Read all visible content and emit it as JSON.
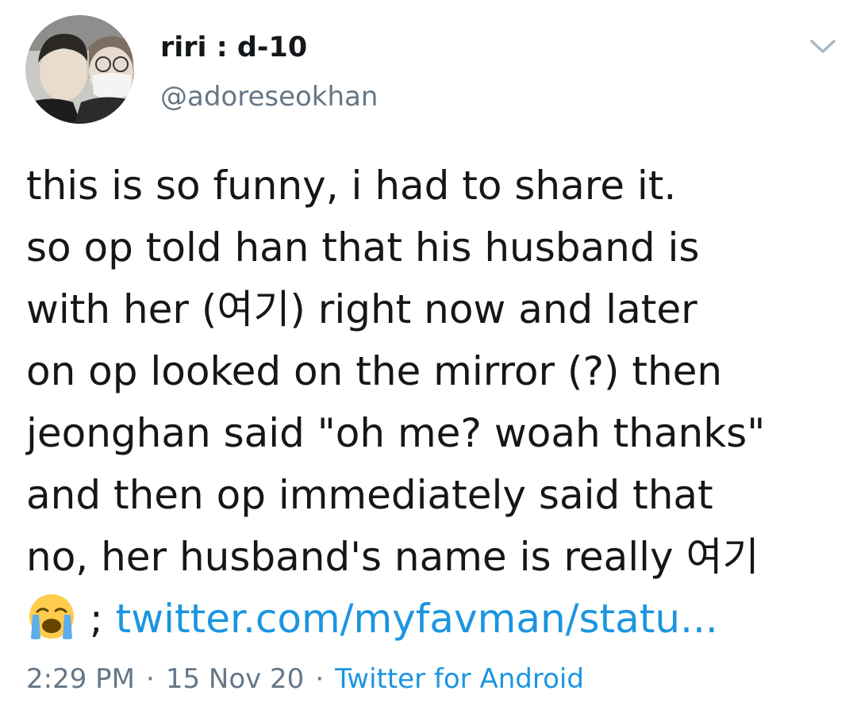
{
  "author": {
    "display_name": "riri : d-10",
    "handle": "@adoreseokhan"
  },
  "tweet": {
    "lines": [
      "this is so funny, i had to share it.",
      "so op told han that his husband is",
      "with her (여기) right now and later",
      "on op looked on the mirror (?) then",
      "jeonghan said \"oh me? woah thanks\"",
      "and then op immediately said that",
      "no, her husband's name is really 여기"
    ],
    "last_line": {
      "emoji": "loudly-crying-face",
      "separator": " ; ",
      "link_text": "twitter.com/myfavman/statu..."
    }
  },
  "meta": {
    "time": "2:29 PM",
    "dot": "·",
    "date": "15 Nov 20",
    "source": "Twitter for Android"
  },
  "icons": {
    "menu": "chevron-down-icon",
    "emoji": "loudly-crying-face-icon"
  },
  "colors": {
    "text": "#14171a",
    "secondary": "#657786",
    "link": "#1b95e0"
  }
}
